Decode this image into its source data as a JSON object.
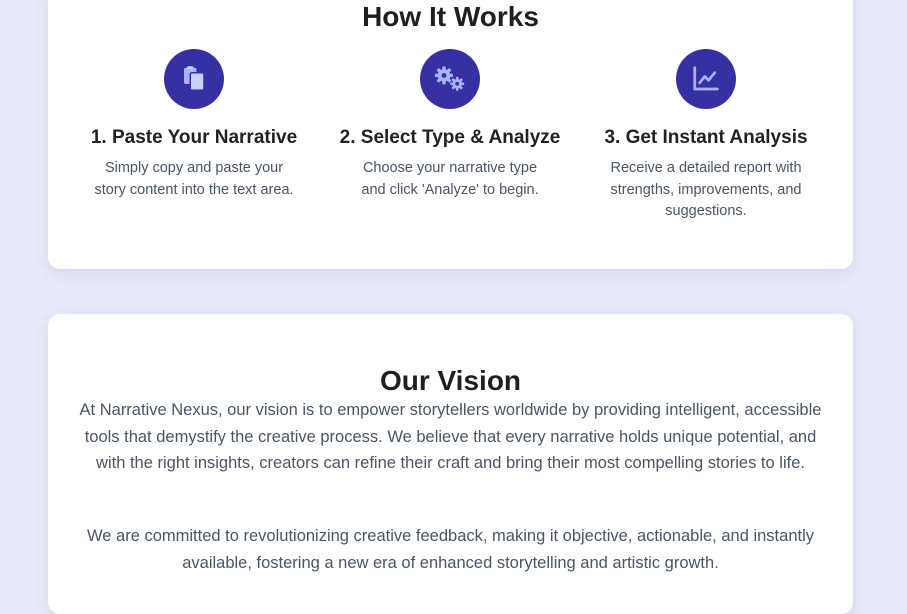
{
  "how_it_works": {
    "title": "How It Works",
    "steps": [
      {
        "icon": "clipboard-copy-icon",
        "title": "1. Paste Your Narrative",
        "description": "Simply copy and paste your story content into the text area."
      },
      {
        "icon": "gears-icon",
        "title": "2. Select Type & Analyze",
        "description": "Choose your narrative type and click 'Analyze' to begin."
      },
      {
        "icon": "chart-line-icon",
        "title": "3. Get Instant Analysis",
        "description": "Receive a detailed report with strengths, improvements, and suggestions."
      }
    ]
  },
  "vision": {
    "title": "Our Vision",
    "paragraphs": [
      "At Narrative Nexus, our vision is to empower storytellers worldwide by providing intelligent, accessible tools that demystify the creative process. We believe that every narrative holds unique potential, and with the right insights, creators can refine their craft and bring their most compelling stories to life.",
      "We are committed to revolutionizing creative feedback, making it objective, actionable, and instantly available, fostering a new era of enhanced storytelling and artistic growth."
    ]
  },
  "colors": {
    "page_background": "#e8eafa",
    "card_background": "#ffffff",
    "icon_circle": "#3730a3",
    "icon_glyph": "#a5b4fc",
    "heading": "#1f1f1f",
    "body_text": "#4b5563"
  }
}
